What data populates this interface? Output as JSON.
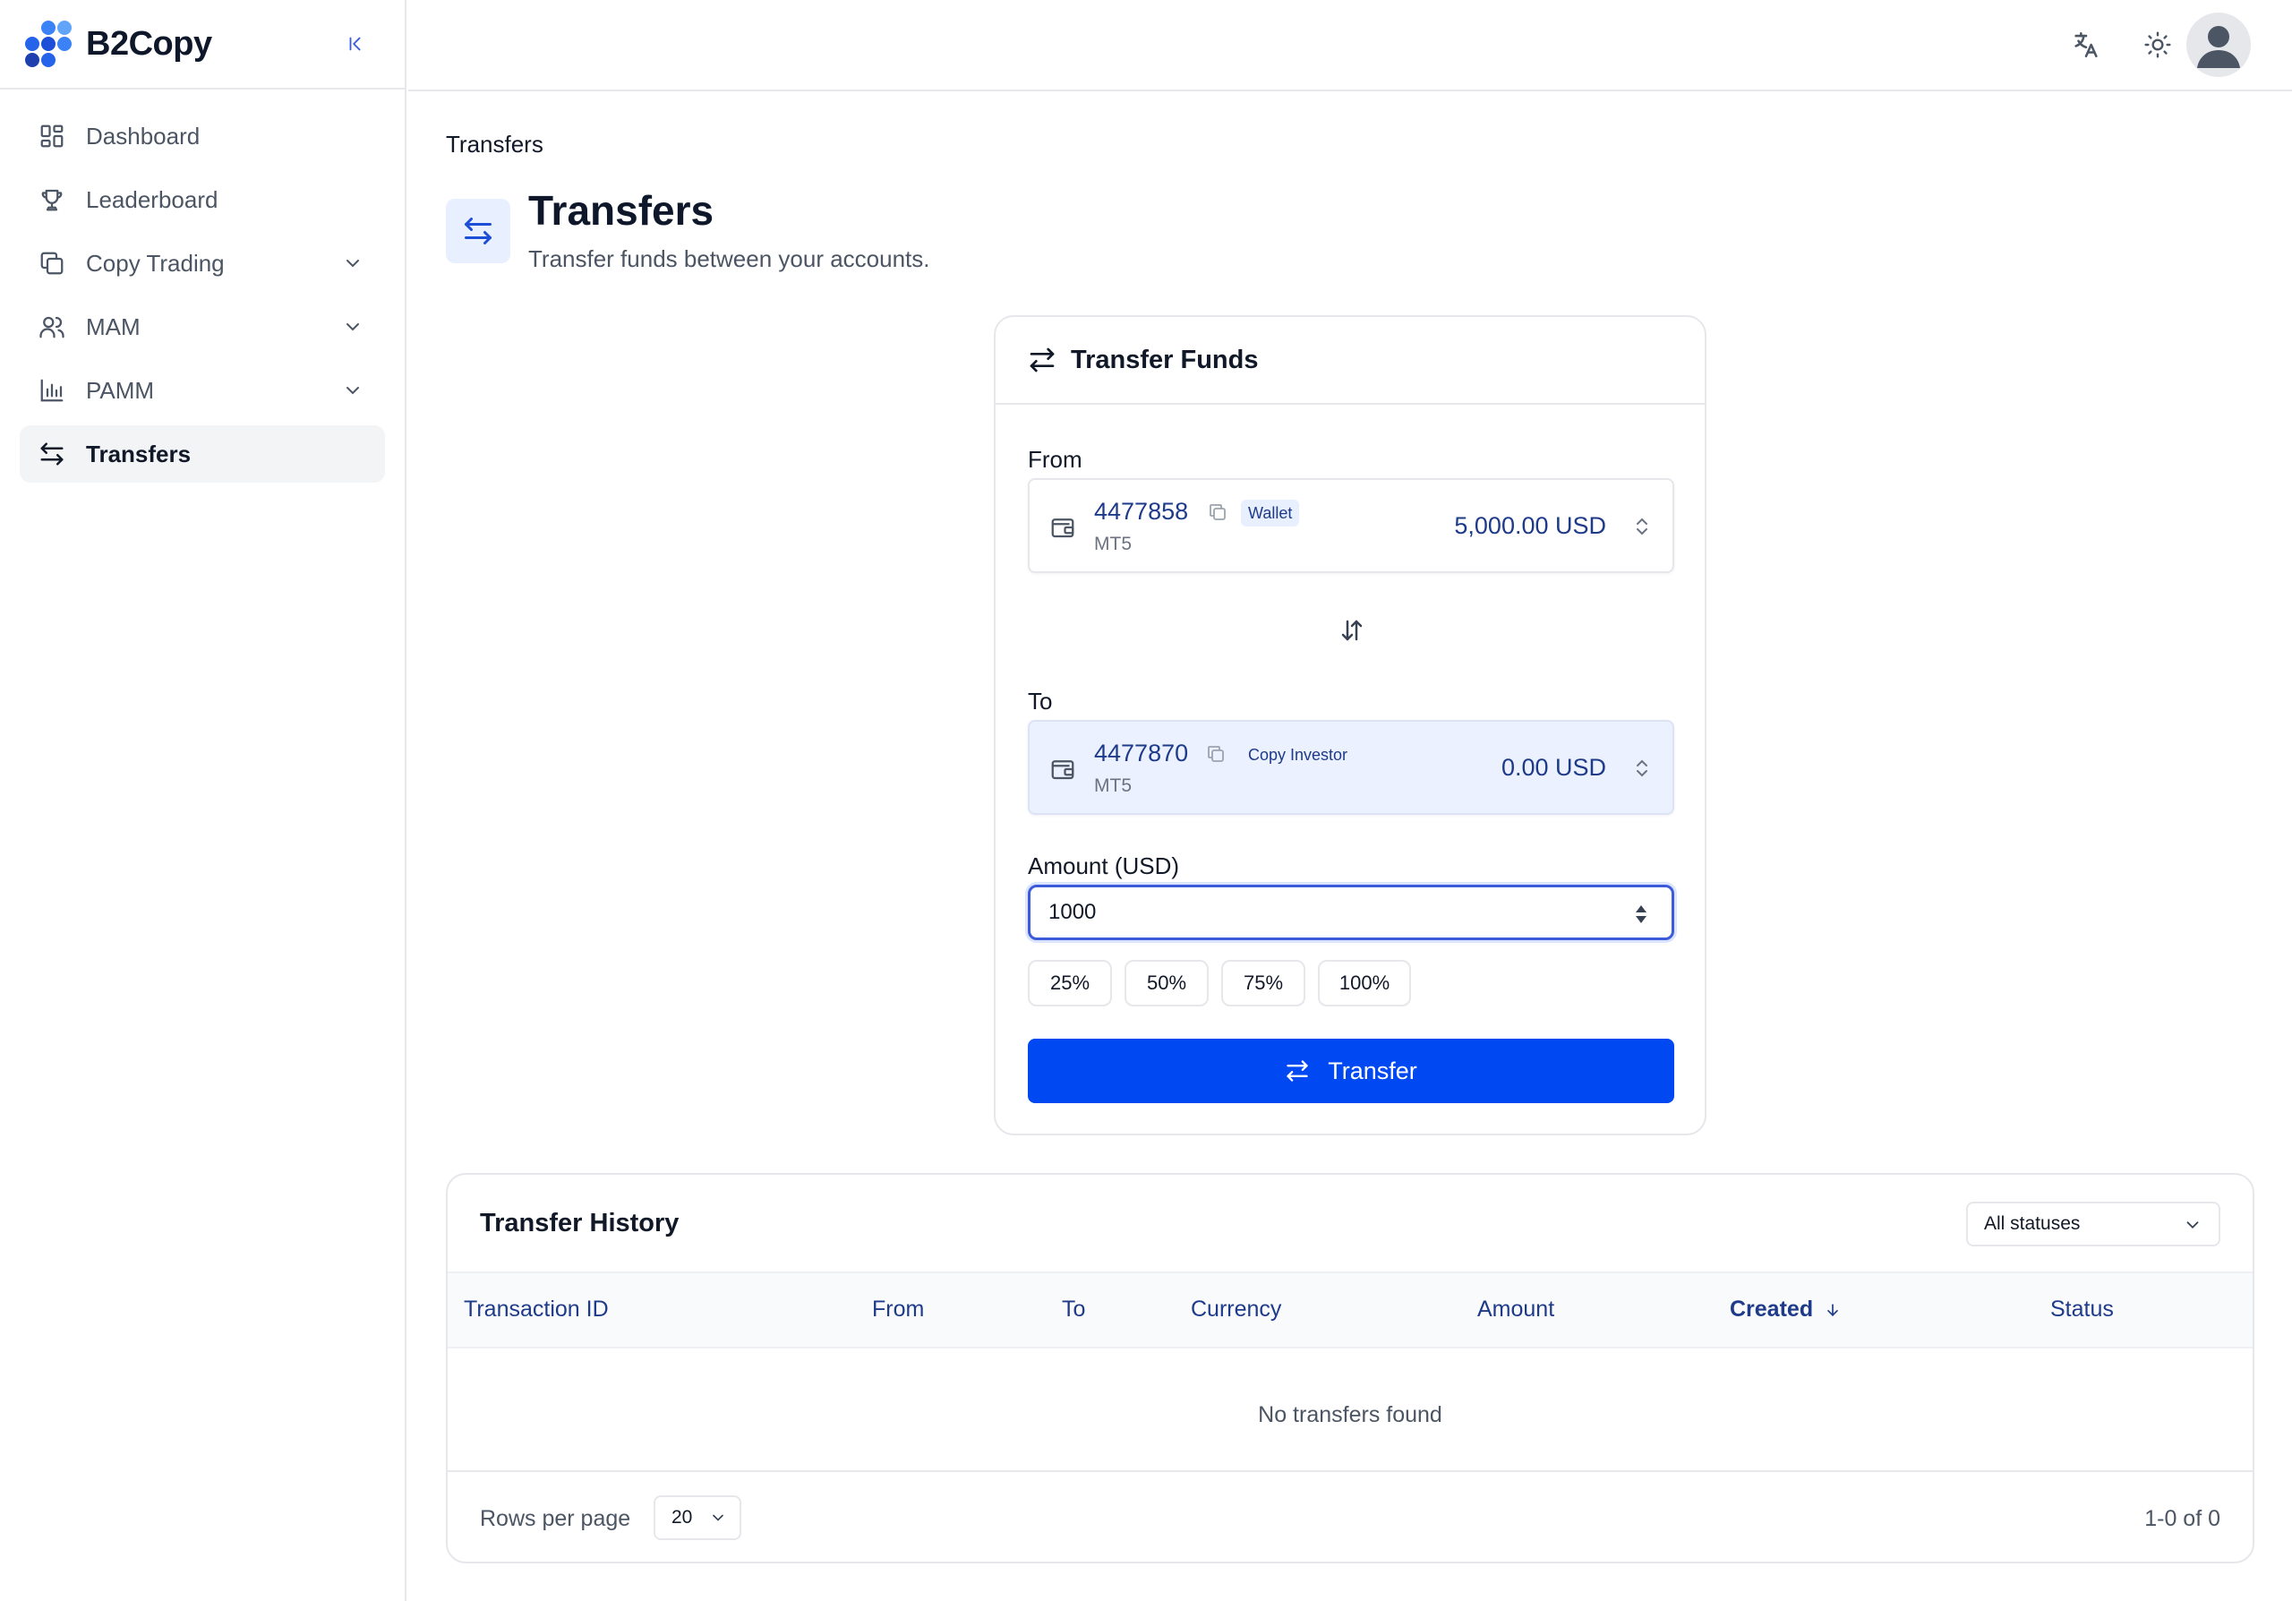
{
  "app": {
    "name": "B2Copy"
  },
  "colors": {
    "accent": "#0049f2",
    "link": "#1e3a8a",
    "logo_dots": [
      "#1d4ed8",
      "#3b82f6",
      "#60a5fa",
      "#2563eb",
      "#1e40af"
    ]
  },
  "sidebar": {
    "items": [
      {
        "label": "Dashboard",
        "icon": "dashboard-icon",
        "expandable": false,
        "active": false
      },
      {
        "label": "Leaderboard",
        "icon": "trophy-icon",
        "expandable": false,
        "active": false
      },
      {
        "label": "Copy Trading",
        "icon": "copy-icon",
        "expandable": true,
        "active": false
      },
      {
        "label": "MAM",
        "icon": "users-icon",
        "expandable": true,
        "active": false
      },
      {
        "label": "PAMM",
        "icon": "bar-chart-icon",
        "expandable": true,
        "active": false
      },
      {
        "label": "Transfers",
        "icon": "arrows-exchange-icon",
        "expandable": false,
        "active": true
      }
    ]
  },
  "topbar": {
    "icons": [
      "translate-icon",
      "sun-icon",
      "user-avatar"
    ]
  },
  "breadcrumb": "Transfers",
  "page": {
    "title": "Transfers",
    "subtitle": "Transfer funds between your accounts."
  },
  "transfer": {
    "title": "Transfer Funds",
    "from": {
      "label": "From",
      "account": "4477858",
      "tag": "Wallet",
      "platform": "MT5",
      "balance": "5,000.00 USD"
    },
    "to": {
      "label": "To",
      "account": "4477870",
      "tag": "Copy Investor",
      "platform": "MT5",
      "balance": "0.00 USD"
    },
    "amount_label": "Amount (USD)",
    "amount_value": "1000",
    "percent_buttons": [
      "25%",
      "50%",
      "75%",
      "100%"
    ],
    "submit_label": "Transfer"
  },
  "history": {
    "title": "Transfer History",
    "status_filter": "All statuses",
    "columns": [
      "Transaction ID",
      "From",
      "To",
      "Currency",
      "Amount",
      "Created",
      "Status"
    ],
    "sorted_column": "Created",
    "sort_direction": "desc",
    "empty_text": "No transfers found",
    "rows_per_page_label": "Rows per page",
    "rows_per_page": "20",
    "pagination": "1-0 of 0"
  }
}
